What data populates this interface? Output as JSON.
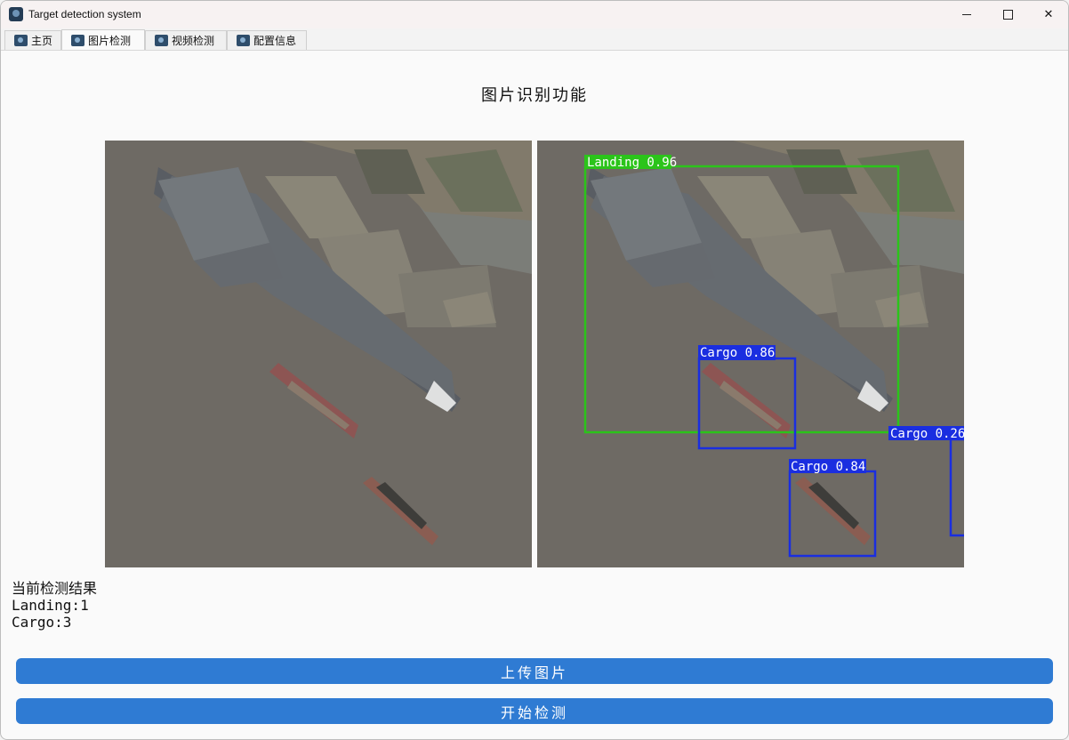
{
  "window": {
    "title": "Target detection system"
  },
  "tabs": [
    {
      "label": "主页",
      "icon": "app-icon"
    },
    {
      "label": "图片检测",
      "icon": "app-icon"
    },
    {
      "label": "视频检测",
      "icon": "app-icon"
    },
    {
      "label": "配置信息",
      "icon": "app-icon"
    }
  ],
  "active_tab": "图片检测",
  "page": {
    "title": "图片识别功能"
  },
  "detections": [
    {
      "label": "Landing 0.96",
      "color": "#2bc41a"
    },
    {
      "label": "Cargo 0.86",
      "color": "#1a2ee0"
    },
    {
      "label": "Cargo 0.84",
      "color": "#1a2ee0"
    },
    {
      "label": "Cargo 0.26",
      "color": "#1a2ee0"
    }
  ],
  "results": {
    "heading": "当前检测结果",
    "line1": "Landing:1",
    "line2": "Cargo:3"
  },
  "buttons": {
    "upload": "上传图片",
    "detect": "开始检测",
    "accent": "#2f7bd3"
  }
}
